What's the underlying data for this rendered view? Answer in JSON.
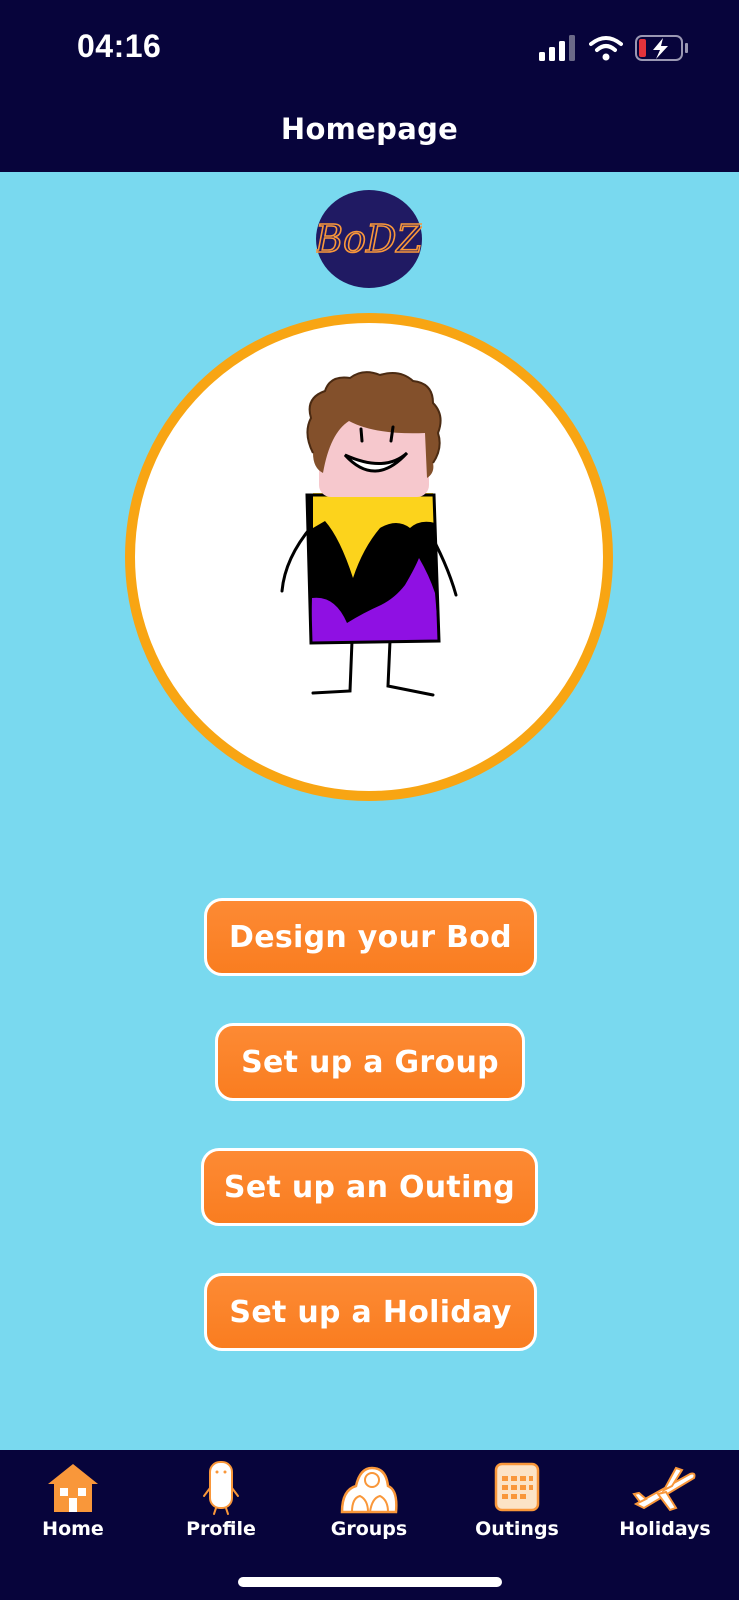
{
  "status_bar": {
    "time": "04:16"
  },
  "header": {
    "title": "Homepage"
  },
  "logo": {
    "text": "BoDZ",
    "bg": "#201a63",
    "text_color": "#f9973a"
  },
  "colors": {
    "background": "#79d9ef",
    "header": "#07043b",
    "accent": "#f8a513",
    "button": "#fd8a34"
  },
  "buttons": {
    "design": "Design your Bod",
    "group": "Set up a Group",
    "outing": "Set up an Outing",
    "holiday": "Set up a Holiday"
  },
  "nav": {
    "items": [
      {
        "label": "Home",
        "icon": "house-icon"
      },
      {
        "label": "Profile",
        "icon": "bod-figure-icon"
      },
      {
        "label": "Groups",
        "icon": "group-icon"
      },
      {
        "label": "Outings",
        "icon": "calendar-icon"
      },
      {
        "label": "Holidays",
        "icon": "airplane-icon"
      }
    ]
  }
}
